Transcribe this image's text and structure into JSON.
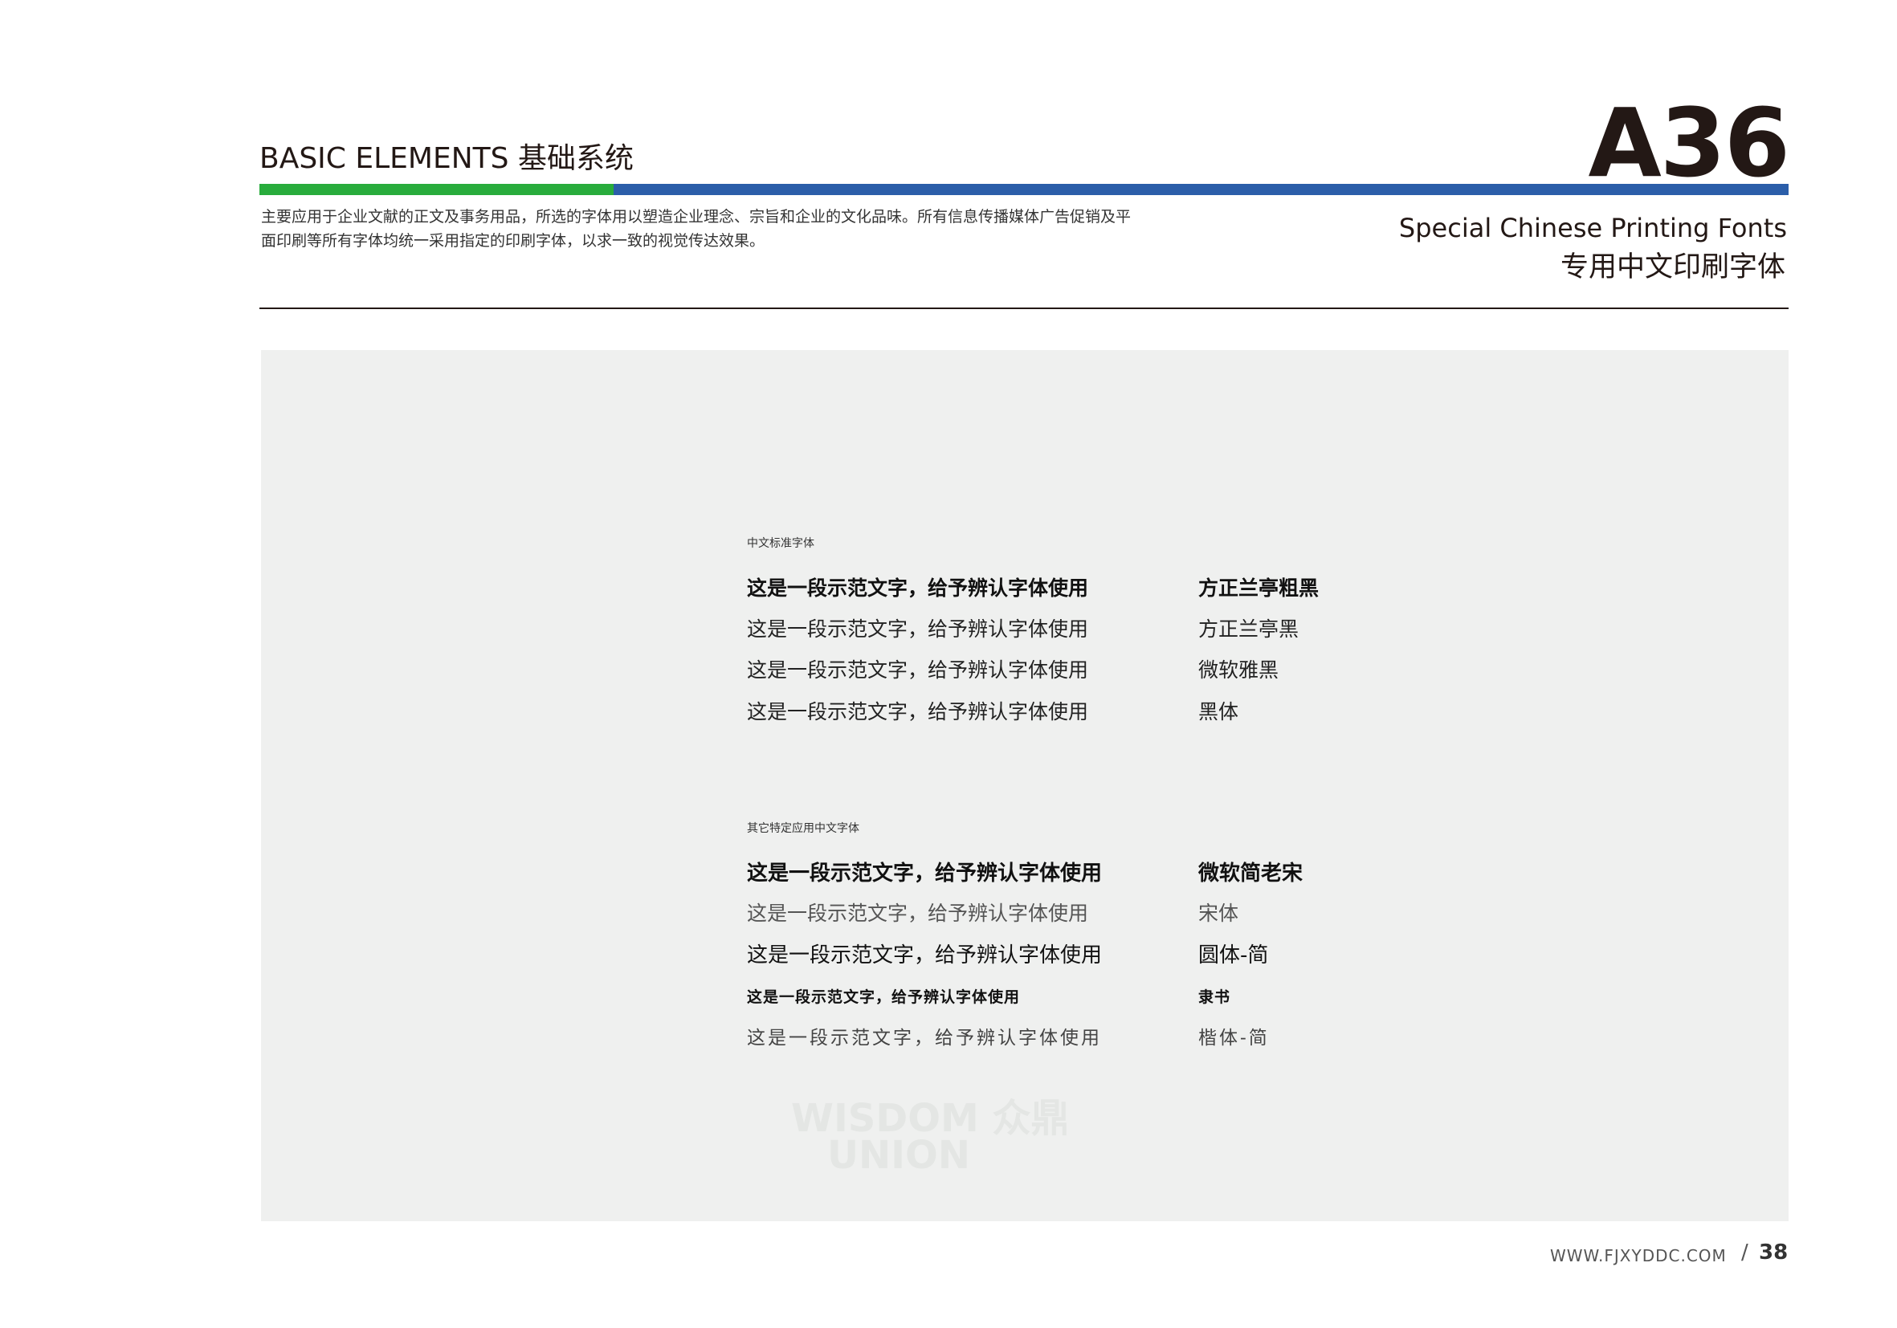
{
  "header": {
    "section_title": "BASIC ELEMENTS 基础系统",
    "page_code": "A36",
    "intro_line1": "主要应用于企业文献的正文及事务用品，所选的字体用以塑造企业理念、宗旨和企业的文化品味。所有信息传播媒体广告促销及平",
    "intro_line2": "面印刷等所有字体均统一采用指定的印刷字体，以求一致的视觉传达效果。",
    "title_en": "Special Chinese Printing Fonts",
    "title_cn": "专用中文印刷字体"
  },
  "colors": {
    "bar_green": "#28ac3c",
    "bar_blue": "#2b5ea9",
    "panel_bg": "#eff0ef"
  },
  "standard": {
    "label": "中文标准字体",
    "rows": [
      {
        "sample": "这是一段示范文字，给予辨认字体使用",
        "font": "方正兰亭粗黑"
      },
      {
        "sample": "这是一段示范文字，给予辨认字体使用",
        "font": "方正兰亭黑"
      },
      {
        "sample": "这是一段示范文字，给予辨认字体使用",
        "font": "微软雅黑"
      },
      {
        "sample": "这是一段示范文字，给予辨认字体使用",
        "font": "黑体"
      }
    ]
  },
  "special": {
    "label": "其它特定应用中文字体",
    "rows": [
      {
        "sample": "这是一段示范文字，给予辨认字体使用",
        "font": "微软简老宋"
      },
      {
        "sample": "这是一段示范文字，给予辨认字体使用",
        "font": "宋体"
      },
      {
        "sample": "这是一段示范文字，给予辨认字体使用",
        "font": "圆体-简"
      },
      {
        "sample": "这是一段示范文字，给予辨认字体使用",
        "font": "隶书"
      },
      {
        "sample": "这是一段示范文字，给予辨认字体使用",
        "font": "楷体-简"
      }
    ]
  },
  "watermark": {
    "line1": "WISDOM 众鼎",
    "line2": "UNION"
  },
  "footer": {
    "url": "WWW.FJXYDDC.COM",
    "slash": "/",
    "page_number": "38"
  }
}
